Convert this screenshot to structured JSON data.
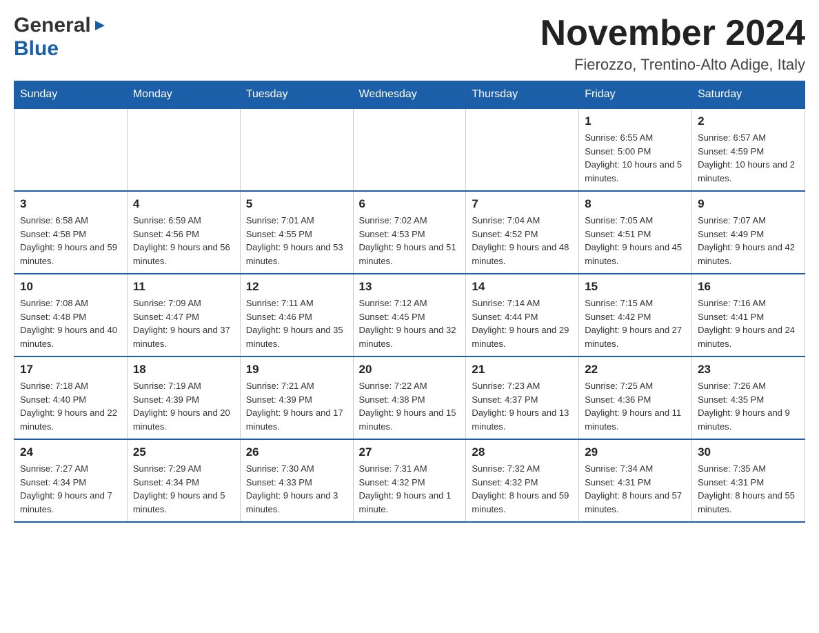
{
  "header": {
    "logo_general": "General",
    "logo_blue": "Blue",
    "title": "November 2024",
    "location": "Fierozzo, Trentino-Alto Adige, Italy"
  },
  "days_of_week": [
    "Sunday",
    "Monday",
    "Tuesday",
    "Wednesday",
    "Thursday",
    "Friday",
    "Saturday"
  ],
  "weeks": [
    [
      {
        "day": "",
        "info": ""
      },
      {
        "day": "",
        "info": ""
      },
      {
        "day": "",
        "info": ""
      },
      {
        "day": "",
        "info": ""
      },
      {
        "day": "",
        "info": ""
      },
      {
        "day": "1",
        "info": "Sunrise: 6:55 AM\nSunset: 5:00 PM\nDaylight: 10 hours and 5 minutes."
      },
      {
        "day": "2",
        "info": "Sunrise: 6:57 AM\nSunset: 4:59 PM\nDaylight: 10 hours and 2 minutes."
      }
    ],
    [
      {
        "day": "3",
        "info": "Sunrise: 6:58 AM\nSunset: 4:58 PM\nDaylight: 9 hours and 59 minutes."
      },
      {
        "day": "4",
        "info": "Sunrise: 6:59 AM\nSunset: 4:56 PM\nDaylight: 9 hours and 56 minutes."
      },
      {
        "day": "5",
        "info": "Sunrise: 7:01 AM\nSunset: 4:55 PM\nDaylight: 9 hours and 53 minutes."
      },
      {
        "day": "6",
        "info": "Sunrise: 7:02 AM\nSunset: 4:53 PM\nDaylight: 9 hours and 51 minutes."
      },
      {
        "day": "7",
        "info": "Sunrise: 7:04 AM\nSunset: 4:52 PM\nDaylight: 9 hours and 48 minutes."
      },
      {
        "day": "8",
        "info": "Sunrise: 7:05 AM\nSunset: 4:51 PM\nDaylight: 9 hours and 45 minutes."
      },
      {
        "day": "9",
        "info": "Sunrise: 7:07 AM\nSunset: 4:49 PM\nDaylight: 9 hours and 42 minutes."
      }
    ],
    [
      {
        "day": "10",
        "info": "Sunrise: 7:08 AM\nSunset: 4:48 PM\nDaylight: 9 hours and 40 minutes."
      },
      {
        "day": "11",
        "info": "Sunrise: 7:09 AM\nSunset: 4:47 PM\nDaylight: 9 hours and 37 minutes."
      },
      {
        "day": "12",
        "info": "Sunrise: 7:11 AM\nSunset: 4:46 PM\nDaylight: 9 hours and 35 minutes."
      },
      {
        "day": "13",
        "info": "Sunrise: 7:12 AM\nSunset: 4:45 PM\nDaylight: 9 hours and 32 minutes."
      },
      {
        "day": "14",
        "info": "Sunrise: 7:14 AM\nSunset: 4:44 PM\nDaylight: 9 hours and 29 minutes."
      },
      {
        "day": "15",
        "info": "Sunrise: 7:15 AM\nSunset: 4:42 PM\nDaylight: 9 hours and 27 minutes."
      },
      {
        "day": "16",
        "info": "Sunrise: 7:16 AM\nSunset: 4:41 PM\nDaylight: 9 hours and 24 minutes."
      }
    ],
    [
      {
        "day": "17",
        "info": "Sunrise: 7:18 AM\nSunset: 4:40 PM\nDaylight: 9 hours and 22 minutes."
      },
      {
        "day": "18",
        "info": "Sunrise: 7:19 AM\nSunset: 4:39 PM\nDaylight: 9 hours and 20 minutes."
      },
      {
        "day": "19",
        "info": "Sunrise: 7:21 AM\nSunset: 4:39 PM\nDaylight: 9 hours and 17 minutes."
      },
      {
        "day": "20",
        "info": "Sunrise: 7:22 AM\nSunset: 4:38 PM\nDaylight: 9 hours and 15 minutes."
      },
      {
        "day": "21",
        "info": "Sunrise: 7:23 AM\nSunset: 4:37 PM\nDaylight: 9 hours and 13 minutes."
      },
      {
        "day": "22",
        "info": "Sunrise: 7:25 AM\nSunset: 4:36 PM\nDaylight: 9 hours and 11 minutes."
      },
      {
        "day": "23",
        "info": "Sunrise: 7:26 AM\nSunset: 4:35 PM\nDaylight: 9 hours and 9 minutes."
      }
    ],
    [
      {
        "day": "24",
        "info": "Sunrise: 7:27 AM\nSunset: 4:34 PM\nDaylight: 9 hours and 7 minutes."
      },
      {
        "day": "25",
        "info": "Sunrise: 7:29 AM\nSunset: 4:34 PM\nDaylight: 9 hours and 5 minutes."
      },
      {
        "day": "26",
        "info": "Sunrise: 7:30 AM\nSunset: 4:33 PM\nDaylight: 9 hours and 3 minutes."
      },
      {
        "day": "27",
        "info": "Sunrise: 7:31 AM\nSunset: 4:32 PM\nDaylight: 9 hours and 1 minute."
      },
      {
        "day": "28",
        "info": "Sunrise: 7:32 AM\nSunset: 4:32 PM\nDaylight: 8 hours and 59 minutes."
      },
      {
        "day": "29",
        "info": "Sunrise: 7:34 AM\nSunset: 4:31 PM\nDaylight: 8 hours and 57 minutes."
      },
      {
        "day": "30",
        "info": "Sunrise: 7:35 AM\nSunset: 4:31 PM\nDaylight: 8 hours and 55 minutes."
      }
    ]
  ]
}
